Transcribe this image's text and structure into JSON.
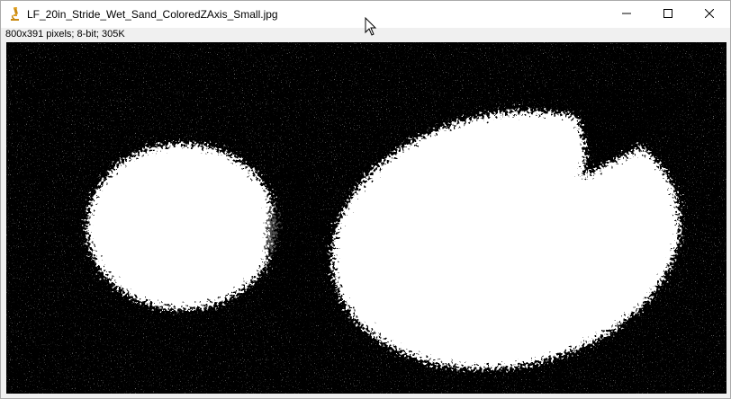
{
  "window": {
    "title": "LF_20in_Stride_Wet_Sand_ColoredZAxis_Small.jpg",
    "app_icon": "microscope-icon",
    "controls": [
      "minimize-icon",
      "maximize-icon",
      "close-icon"
    ]
  },
  "info": {
    "text": "800x391 pixels; 8-bit; 305K"
  },
  "image": {
    "description_colors": {
      "background": "#000000",
      "foreground": "#ffffff"
    }
  }
}
